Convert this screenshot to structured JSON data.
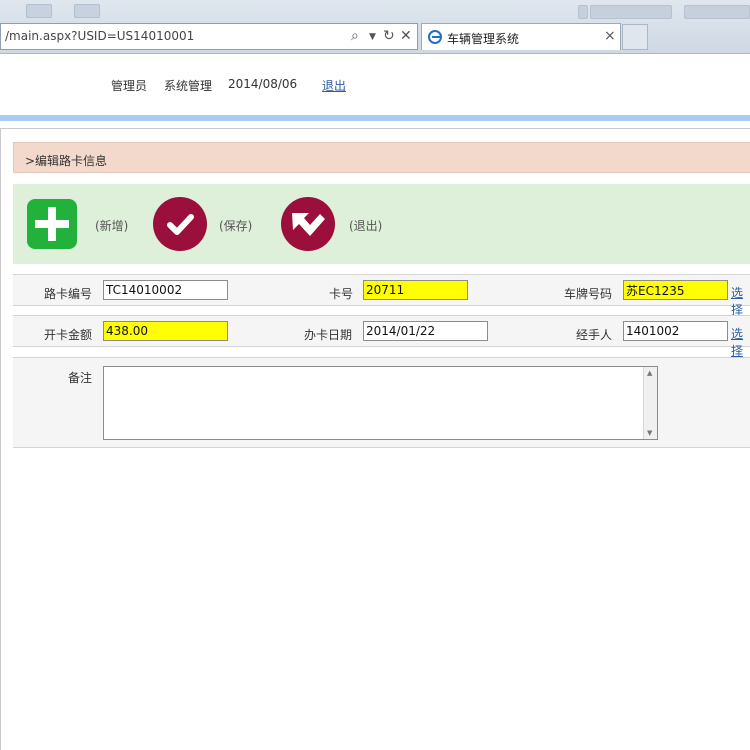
{
  "browser": {
    "address": "/main.aspx?USID=US14010001",
    "tab_title": "车辆管理系统"
  },
  "header": {
    "role": "管理员",
    "system": "系统管理",
    "date": "2014/08/06",
    "logout": "退出"
  },
  "section_title": ">编辑路卡信息",
  "toolbar": {
    "add_label": "(新增)",
    "save_label": "(保存)",
    "exit_label": "(退出)"
  },
  "form": {
    "card_no_label": "路卡编号",
    "card_no": "TC14010002",
    "card_label": "卡号",
    "card": "20711",
    "plate_label": "车牌号码",
    "plate": "苏EC1235",
    "select_label": "选择",
    "amount_label": "开卡金额",
    "amount": "438.00",
    "issue_date_label": "办卡日期",
    "issue_date": "2014/01/22",
    "handler_label": "经手人",
    "handler": "1401002",
    "remark_label": "备注",
    "remark": ""
  },
  "colors": {
    "highlight": "#ffff00",
    "add_green": "#22b13a",
    "action_red": "#9a0f3b"
  }
}
